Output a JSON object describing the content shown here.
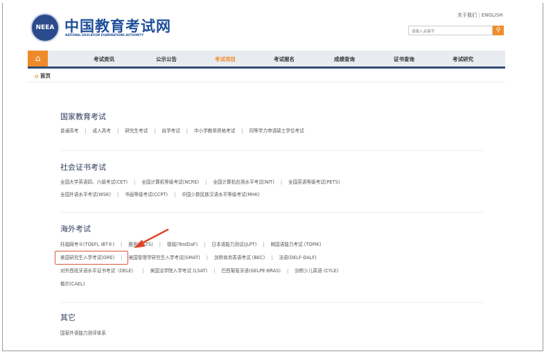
{
  "header": {
    "logo_text": "NEEA",
    "title": "中国教育考试网",
    "subtitle": "NATIONAL EDUCATION EXAMINATIONS AUTHORITY",
    "about": "关于我们",
    "english": "ENGLISH",
    "search_placeholder": "请输入关键字",
    "search_icon": "search-icon"
  },
  "nav": {
    "home_icon": "home-icon",
    "items": [
      "考试资讯",
      "公示公告",
      "考试项目",
      "考试报名",
      "成绩查询",
      "证书查询",
      "考试研究"
    ],
    "active": "考试项目"
  },
  "breadcrumb": "首页",
  "sections": [
    {
      "title": "国家教育考试",
      "rows": [
        [
          "普通高考",
          "成人高考",
          "研究生考试",
          "自学考试",
          "中小学教师资格考试",
          "同等学力申请硕士学位考试"
        ]
      ]
    },
    {
      "title": "社会证书考试",
      "rows": [
        [
          "全国大学英语四、六级考试(CET)",
          "全国计算机等级考试(NCRE)",
          "全国计算机应用水平考试(NIT)",
          "全国英语等级考试(PETS)"
        ],
        [
          "全国外语水平考试(WSK)",
          "书画等级考试(CCPT)",
          "中国少数民族汉语水平等级考试(MHK)"
        ]
      ]
    },
    {
      "title": "海外考试",
      "rows": [
        [
          "托福网考®(TOEFL iBT®)",
          "雅思(IELTS)",
          "德福(TestDaF)",
          "日本语能力测试(JLPT)",
          "韩国语能力考试 (TOPIK)"
        ],
        [
          "美国研究生入学考试(GRE)",
          "美国管理学研究生入学考试(GMAT)",
          "剑桥商务英语考试 (BEC)",
          "法语(DELF-DALF)"
        ],
        [
          "对外西班牙语水平证书考试（DELE）",
          "美国法学院入学考试 (LSAT)",
          "巴西葡萄牙语(GELPE-BRAS)",
          "剑桥少儿英语 (CYLE)"
        ],
        [
          "楷尔(CAEL)"
        ]
      ]
    },
    {
      "title": "其它",
      "rows": [
        [
          "国家外语能力测评体系"
        ]
      ]
    }
  ],
  "highlight": "美国研究生入学考试(GRE)",
  "colors": {
    "accent": "#ef8a2e",
    "brand": "#1f4e9a",
    "highlight": "#d9553e"
  }
}
